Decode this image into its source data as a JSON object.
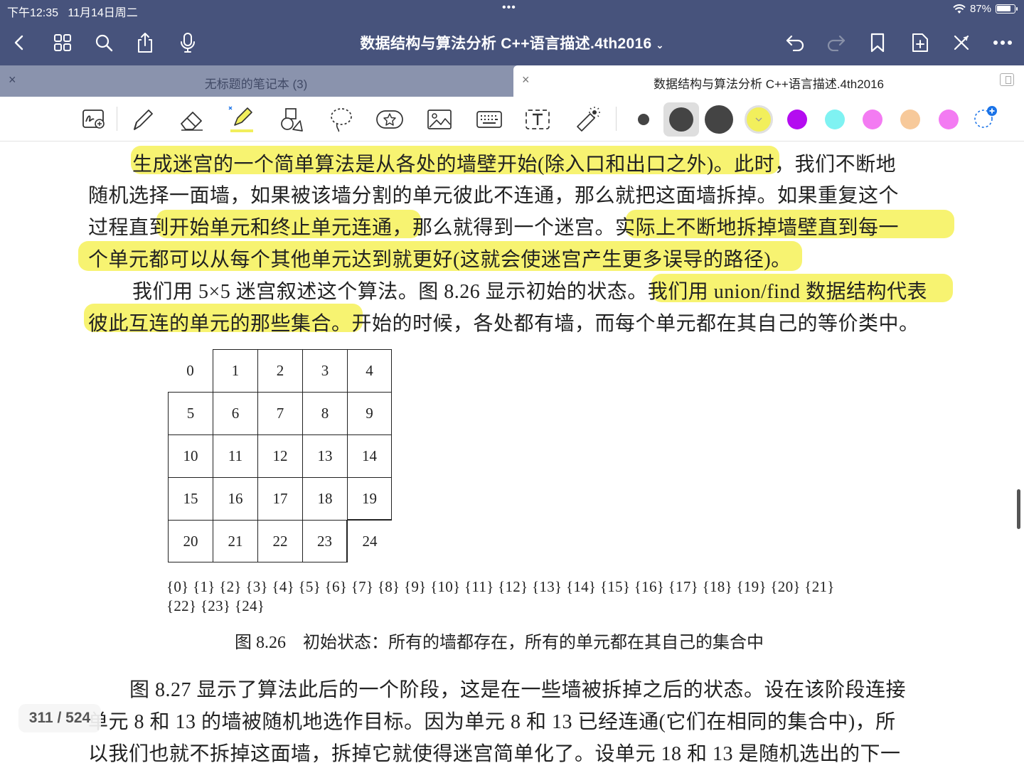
{
  "status": {
    "time": "下午12:35",
    "date": "11月14日周二",
    "dots": "•••",
    "battery": "87%",
    "battery_level": 0.87
  },
  "nav": {
    "title": "数据结构与算法分析 C++语言描述.4th2016",
    "icons": [
      "back-icon",
      "grid-icon",
      "search-icon",
      "share-icon",
      "microphone-icon",
      "undo-icon",
      "redo-icon",
      "bookmark-icon",
      "add-page-icon",
      "close-mode-icon",
      "more-icon"
    ]
  },
  "tabs": [
    {
      "label": "无标题的笔记本 (3)",
      "close": "×",
      "active": false
    },
    {
      "label": "数据结构与算法分析 C++语言描述.4th2016",
      "close": "×",
      "active": true
    }
  ],
  "toolbar": {
    "tools": [
      "zoom-draw-icon",
      "pen-icon",
      "eraser-icon",
      "highlighter-icon",
      "shapes-icon",
      "lasso-icon",
      "sticker-icon",
      "image-icon",
      "keyboard-icon",
      "text-box-icon",
      "laser-pointer-icon"
    ],
    "colors": [
      "#444444",
      "#444444",
      "#444444",
      "#f2ef5c",
      "#b40cf0",
      "#7ff2f2",
      "#f37bf2",
      "#f7c99a",
      "#f37bf2"
    ],
    "selected_color": "#f2ef5c"
  },
  "document": {
    "lines": [
      "生成迷宫的一个简单算法是从各处的墙壁开始(除入口和出口之外)。此时，我们不断地",
      "随机选择一面墙，如果被该墙分割的单元彼此不连通，那么就把这面墙拆掉。如果重复这个",
      "过程直到开始单元和终止单元连通，那么就得到一个迷宫。实际上不断地拆掉墙壁直到每一",
      "个单元都可以从每个其他单元达到就更好(这就会使迷宫产生更多误导的路径)。",
      "我们用 5×5 迷宫叙述这个算法。图 8.26 显示初始的状态。我们用 union/find 数据结构代表",
      "彼此互连的单元的那些集合。开始的时候，各处都有墙，而每个单元都在其自己的等价类中。"
    ],
    "maze_cells": [
      "0",
      "1",
      "2",
      "3",
      "4",
      "5",
      "6",
      "7",
      "8",
      "9",
      "10",
      "11",
      "12",
      "13",
      "14",
      "15",
      "16",
      "17",
      "18",
      "19",
      "20",
      "21",
      "22",
      "23",
      "24"
    ],
    "sets_line1": "{0} {1} {2} {3} {4} {5} {6} {7} {8} {9} {10} {11} {12} {13} {14} {15} {16} {17} {18} {19} {20} {21}",
    "sets_line2": "{22} {23} {24}",
    "caption": "图 8.26　初始状态：所有的墙都存在，所有的单元都在其自己的集合中",
    "lines2": [
      "图 8.27 显示了算法此后的一个阶段，这是在一些墙被拆掉之后的状态。设在该阶段连接",
      "单元 8 和 13 的墙被随机地选作目标。因为单元 8 和 13 已经连通(它们在相同的集合中)，所",
      "以我们也就不拆掉这面墙，拆掉它就使得迷宫简单化了。设单元 18 和 13 是随机选出的下一"
    ],
    "highlight_color": "#f7f269"
  },
  "page_indicator": "311 / 524"
}
